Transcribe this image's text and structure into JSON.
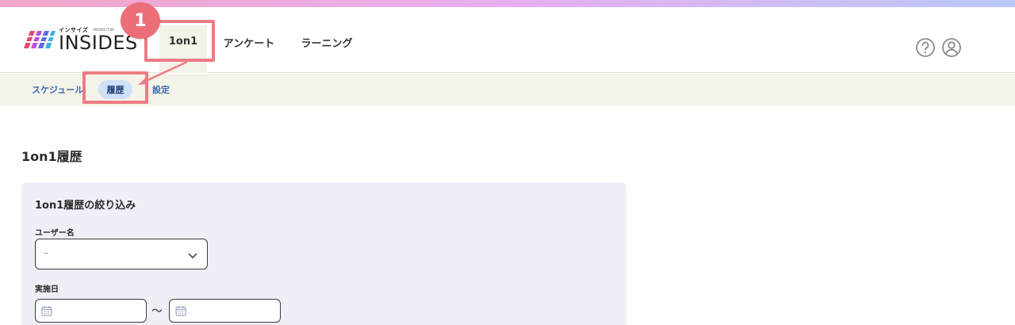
{
  "logo": {
    "katakana": "インサイズ",
    "product_by": "PRODUCT BY",
    "word": "INSIDES"
  },
  "nav": {
    "tabs": [
      {
        "label": "1on1",
        "active": true
      },
      {
        "label": "アンケート",
        "active": false
      },
      {
        "label": "ラーニング",
        "active": false
      }
    ]
  },
  "annotation": {
    "step_number": "1",
    "highlight_color": "#ee7b84"
  },
  "header_icons": [
    "help-icon",
    "user-icon"
  ],
  "subnav": {
    "items": [
      {
        "label": "スケジュール",
        "active": false
      },
      {
        "label": "履歴",
        "active": true
      },
      {
        "label": "設定",
        "active": false
      }
    ]
  },
  "page": {
    "title": "1on1履歴"
  },
  "filter": {
    "title": "1on1履歴の絞り込み",
    "user_label": "ユーザー名",
    "user_value": "–",
    "date_label": "実施日",
    "date_separator": "〜",
    "date_from_value": "",
    "date_to_value": ""
  },
  "colors": {
    "accent_link": "#3a69b0",
    "active_pill": "#cfe1f7",
    "subnav_bg": "#f4f3e9",
    "panel_bg": "#efeff8"
  }
}
